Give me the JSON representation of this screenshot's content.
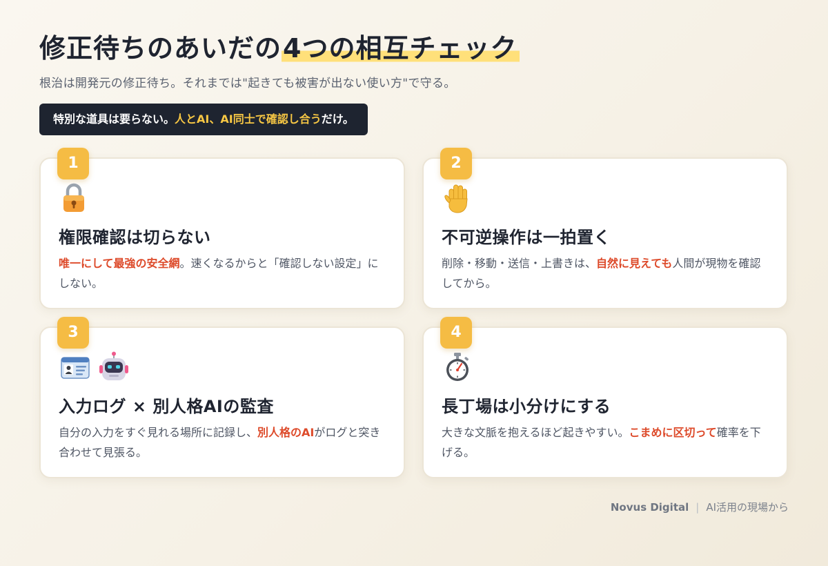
{
  "header": {
    "title_main": "修正待ちのあいだの",
    "title_highlight": "4つの相互チェック",
    "subtitle": "根治は開発元の修正待ち。それまでは\"起きても被害が出ない使い方\"で守る。"
  },
  "banner": {
    "pre": "特別な道具は要らない。",
    "accent": "人とAI、AI同士で確認し合う",
    "post": "だけ。"
  },
  "colors": {
    "accent_yellow": "#f5bc44",
    "emphasis_red": "#dd4a2a",
    "banner_dark": "#1e2430"
  },
  "cards": [
    {
      "number": "1",
      "icons": [
        "lock-icon"
      ],
      "title": "権限確認は切らない",
      "body_em": "唯一にして最強の安全網",
      "body_rest": "。速くなるからと「確認しない設定」にしない。"
    },
    {
      "number": "2",
      "icons": [
        "raised-hand-icon"
      ],
      "title": "不可逆操作は一拍置く",
      "body_pre": "削除・移動・送信・上書きは、",
      "body_em": "自然に見えても",
      "body_post": "人間が現物を確認してから。"
    },
    {
      "number": "3",
      "icons": [
        "id-card-icon",
        "robot-icon"
      ],
      "title": "入力ログ × 別人格AIの監査",
      "body_pre": "自分の入力をすぐ見れる場所に記録し、",
      "body_em": "別人格のAI",
      "body_post": "がログと突き合わせて見張る。"
    },
    {
      "number": "4",
      "icons": [
        "stopwatch-icon"
      ],
      "title": "長丁場は小分けにする",
      "body_pre": "大きな文脈を抱えるほど起きやすい。",
      "body_em": "こまめに区切って",
      "body_post": "確率を下げる。"
    }
  ],
  "footer": {
    "brand": "Novus Digital",
    "separator": "|",
    "tagline": "AI活用の現場から"
  }
}
